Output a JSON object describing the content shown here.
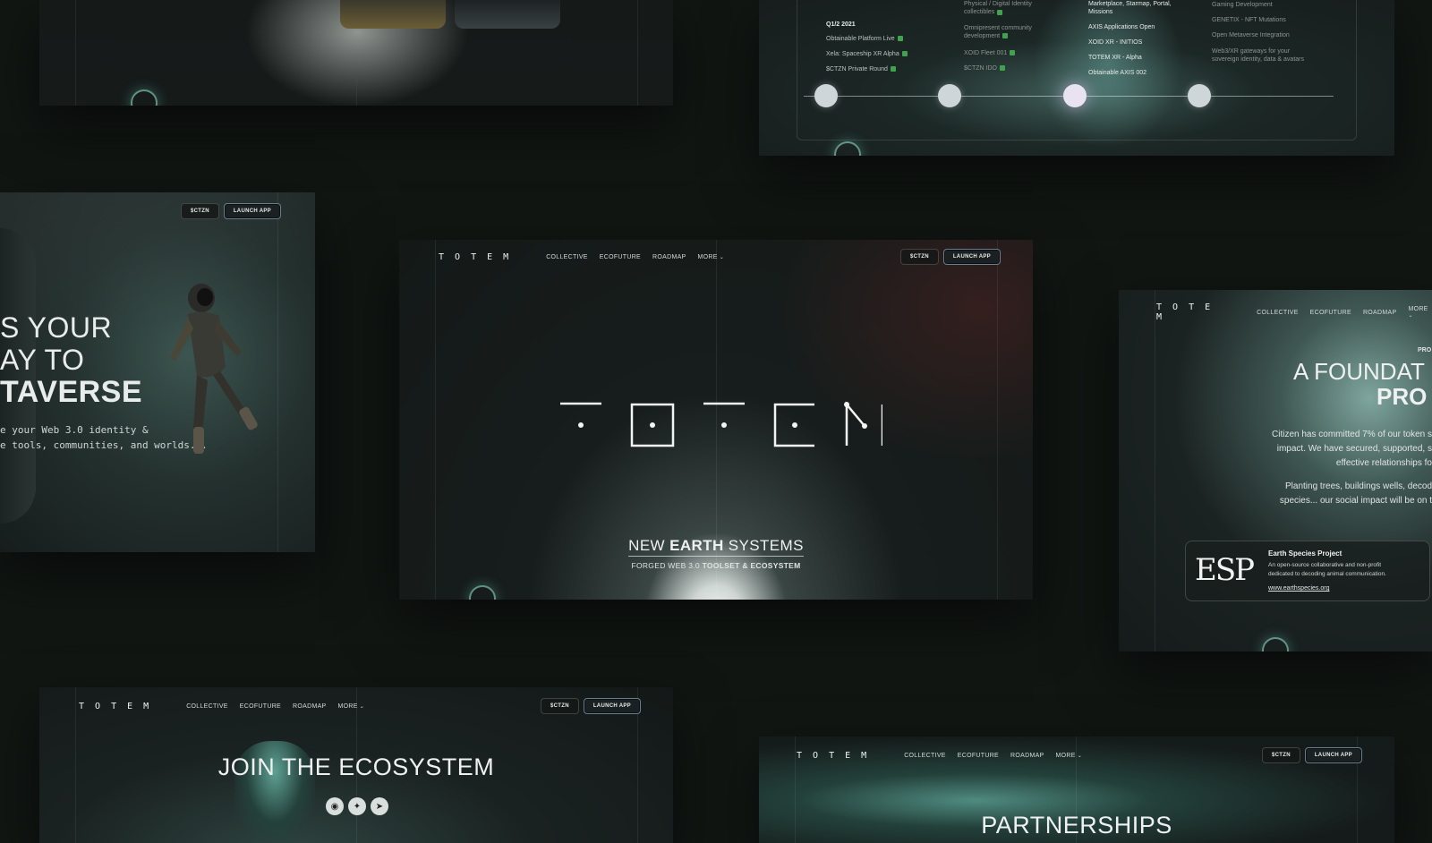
{
  "nav": {
    "logo": "T O T E M",
    "items": [
      "COLLECTIVE",
      "ECOFUTURE",
      "ROADMAP",
      "MORE"
    ],
    "ctzn_button": "$CTZN",
    "launch_button": "LAUNCH APP"
  },
  "roadmap": {
    "col1": {
      "heading": "Q1/2 2021",
      "items": [
        "Obtainable Platform Live",
        "Xela: Spaceship XR Alpha",
        "$CTZN Private Round"
      ]
    },
    "col2": {
      "top": [
        "Physical / Digital Identity",
        "collectibles"
      ],
      "items": [
        "Omnipresent community development",
        "XOID Fleet 001",
        "$CTZN IDO"
      ]
    },
    "col3": {
      "top": [
        "Marketplace, Starmap, Portal,",
        "Missions"
      ],
      "items": [
        "AXIS Applications Open",
        "XOID XR - INITIOS",
        "TOTEM XR - Alpha",
        "Obtainable AXIS 002"
      ]
    },
    "col4": {
      "items": [
        "Gaming Development",
        "GENETIX - NFT Mutations",
        "Open Metaverse Integration",
        "Web3/XR gateways for your sovereign identity, data & avatars"
      ]
    }
  },
  "hero_left": {
    "line1": "S YOUR",
    "line2": "AY TO",
    "line3": "TAVERSE",
    "body1": "e your Web 3.0 identity &",
    "body2": "e tools, communities, and worlds..."
  },
  "hero_center": {
    "logo": "TOTEM",
    "tag_pre": "NEW ",
    "tag_bold": "EARTH",
    "tag_post": " SYSTEMS",
    "sub_pre": "FORGED WEB 3.0 ",
    "sub_bold": "TOOLSET & ECOSYSTEM"
  },
  "foundation": {
    "kicker": "PRO",
    "line1": "A FOUNDAT",
    "line2": "PRO",
    "para1a": "Citizen has committed 7% of our token s",
    "para1b": "impact. We have secured, supported, s",
    "para1c": "effective relationships fo",
    "para2a": "Planting trees, buildings wells, decod",
    "para2b": "species... our social impact will be on t",
    "card_logo": "ESP",
    "card_title": "Earth Species Project",
    "card_body1": "An open-source collaborative and non-profit",
    "card_body2": "dedicated to decoding animal communication.",
    "card_link": "www.earthspecies.org"
  },
  "join": {
    "title": "JOIN THE ECOSYSTEM",
    "icons": [
      "discord-icon",
      "twitter-icon",
      "telegram-icon"
    ]
  },
  "partnerships": {
    "title": "PARTNERSHIPS"
  }
}
